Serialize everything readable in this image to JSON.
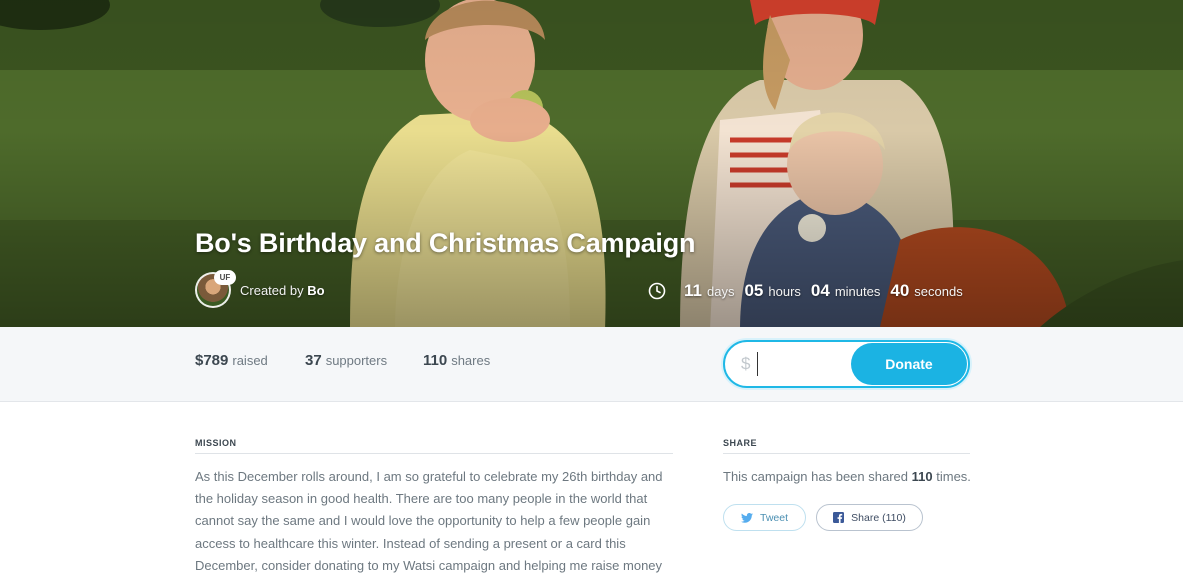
{
  "campaign": {
    "title": "Bo's Birthday and Christmas Campaign",
    "created_by_label": "Created by",
    "creator_name": "Bo",
    "avatar_badge": "UF"
  },
  "countdown": {
    "days": "11",
    "days_label": "days",
    "hours": "05",
    "hours_label": "hours",
    "minutes": "04",
    "minutes_label": "minutes",
    "seconds": "40",
    "seconds_label": "seconds"
  },
  "stats": {
    "raised": "$789",
    "raised_label": "raised",
    "supporters": "37",
    "supporters_label": "supporters",
    "shares": "110",
    "shares_label": "shares"
  },
  "donate": {
    "currency_symbol": "$",
    "amount_value": "",
    "button_label": "Donate"
  },
  "mission": {
    "label": "MISSION",
    "text": "As this December rolls around, I am so grateful to celebrate my 26th birthday and the holiday season in good health. There are too many people in the world that cannot say the same and I would love the opportunity to help a few people gain access to healthcare this winter. Instead of sending a present or a card this December, consider donating to my Watsi campaign and helping me raise money"
  },
  "share": {
    "label": "SHARE",
    "text_before": "This campaign has been shared",
    "count": "110",
    "text_after": "times.",
    "tweet_label": "Tweet",
    "facebook_label": "Share (110)"
  },
  "colors": {
    "accent": "#1bb3e3",
    "text_dark": "#3c4750",
    "text_muted": "#6d7880",
    "stats_bg": "#f5f7f9"
  },
  "icons": [
    "clock-icon",
    "twitter-icon",
    "facebook-icon"
  ]
}
